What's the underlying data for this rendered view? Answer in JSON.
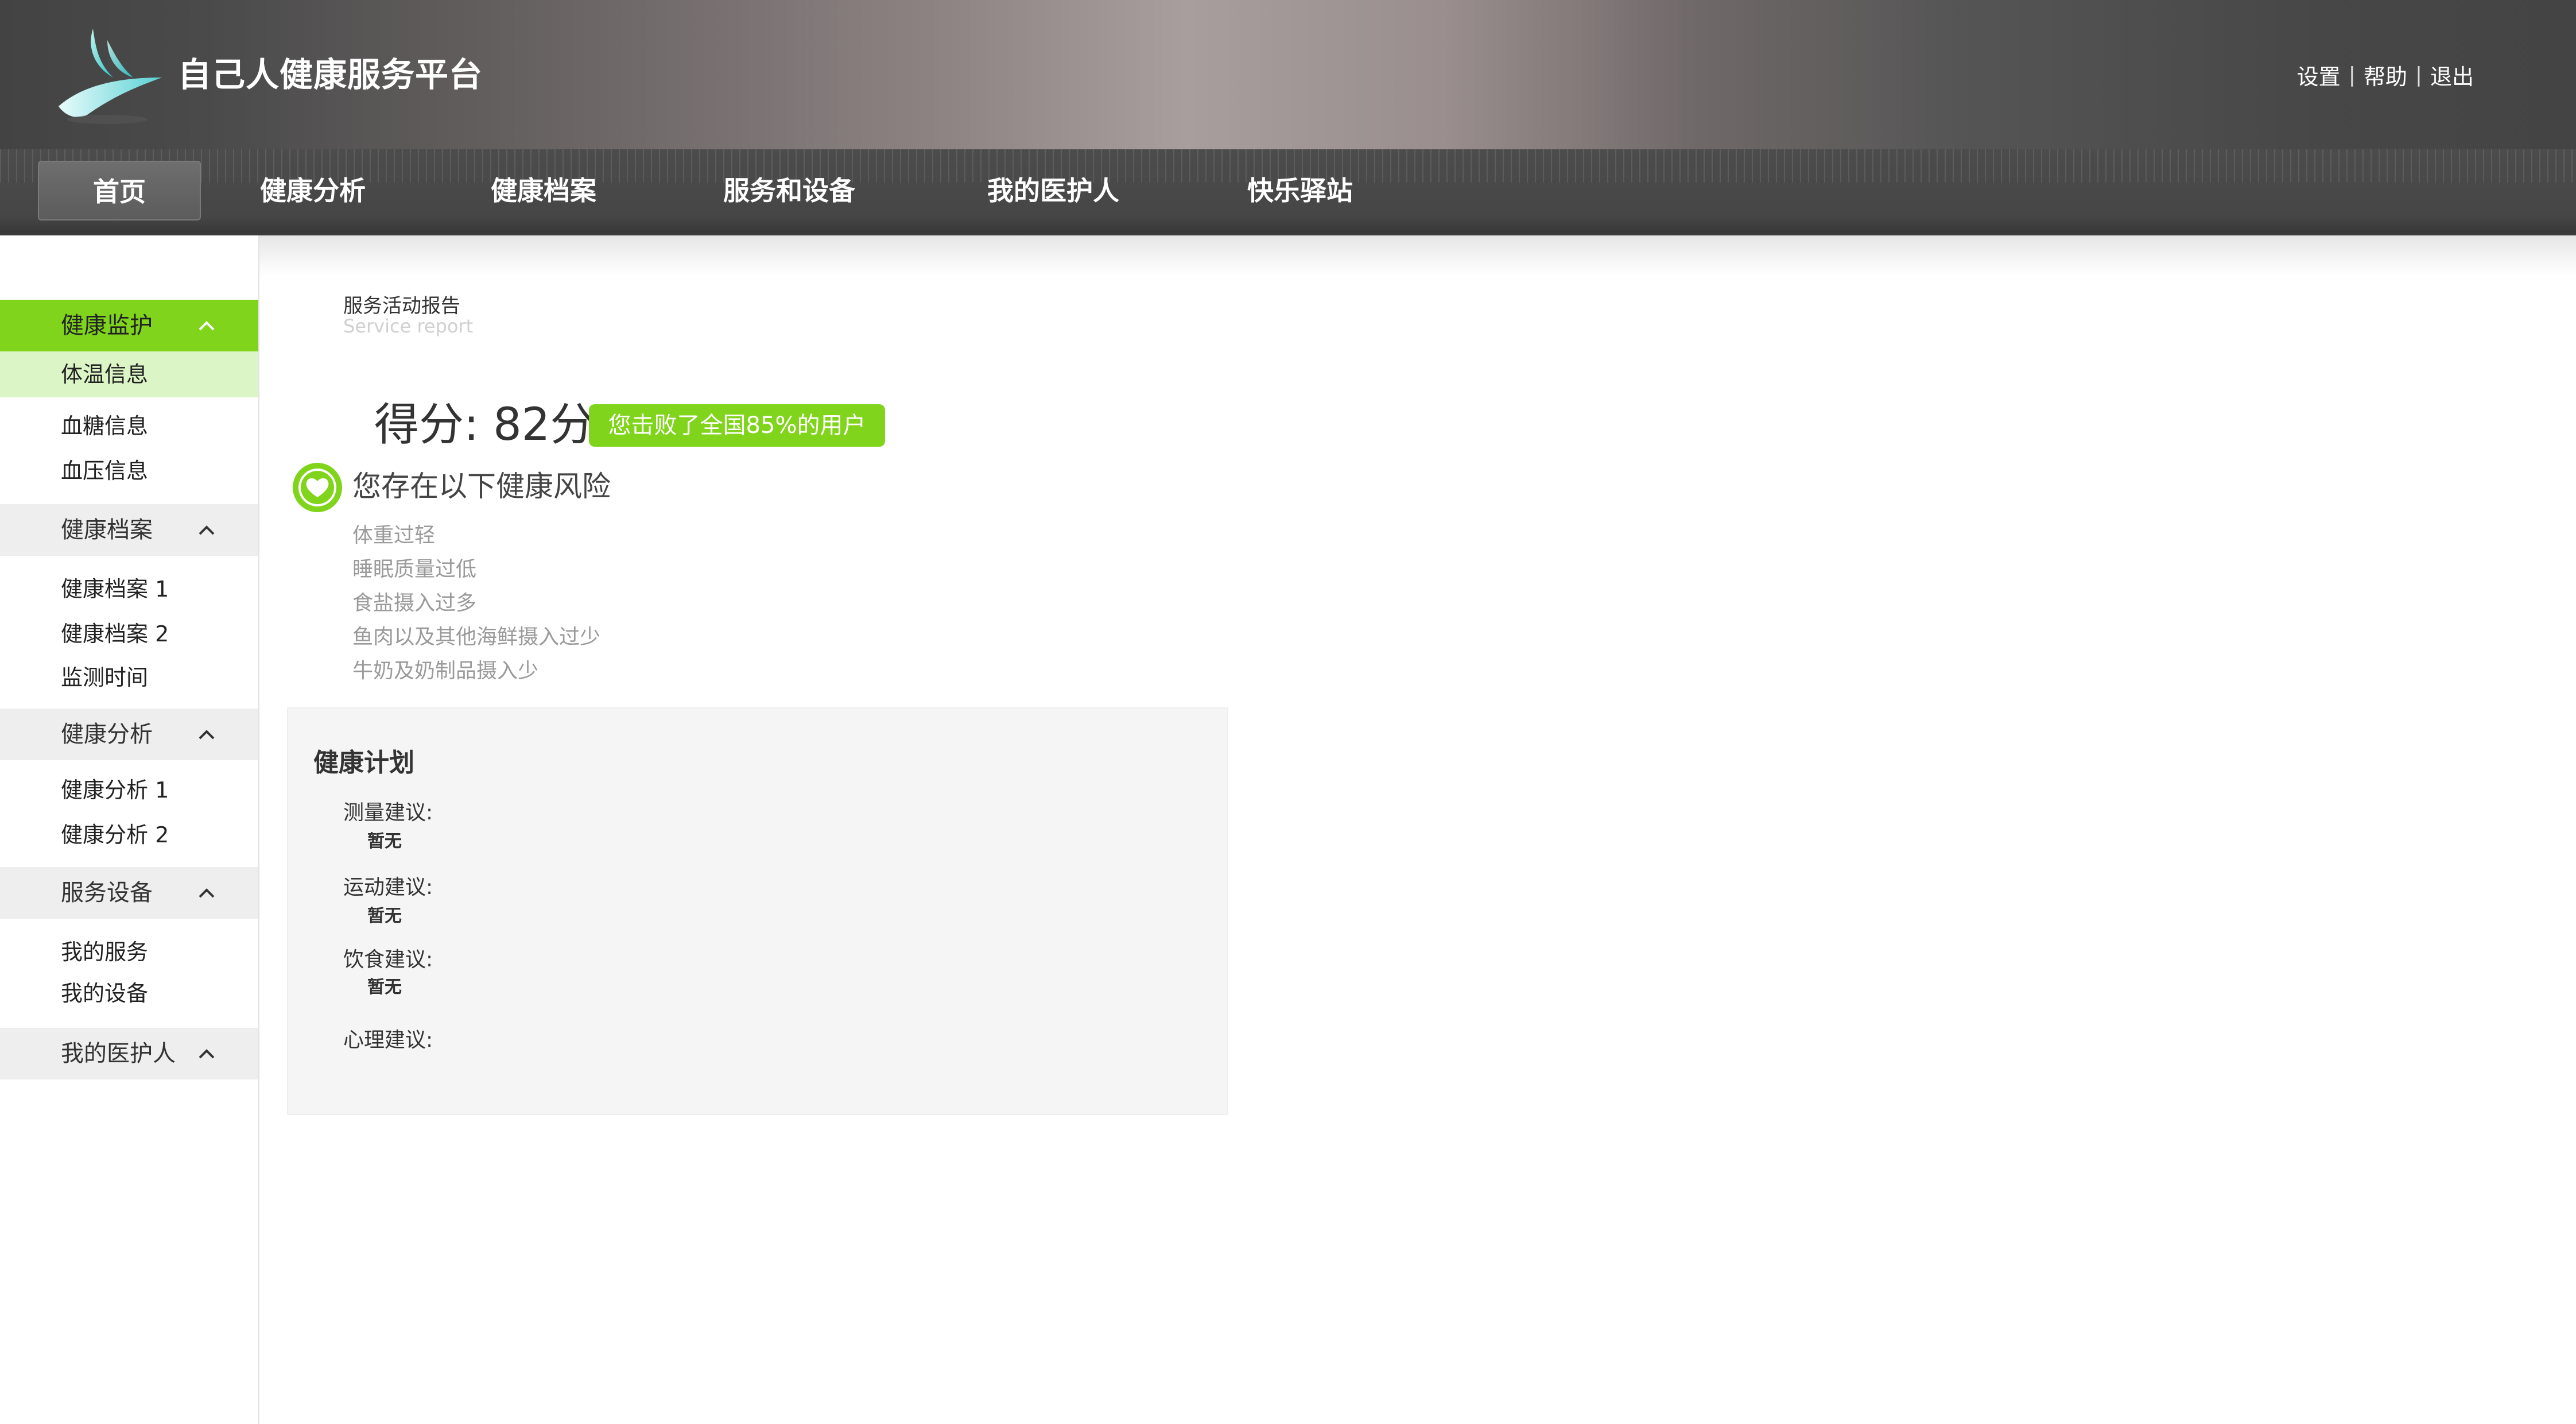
{
  "app": {
    "title": "自己人健康服务平台"
  },
  "top_links": [
    "设置",
    "帮助",
    "退出"
  ],
  "nav": {
    "items": [
      "首页",
      "健康分析",
      "健康档案",
      "服务和设备",
      "我的医护人",
      "快乐驿站"
    ],
    "active": "首页"
  },
  "sidebar": {
    "groups": [
      {
        "label": "健康监护",
        "expanded": true,
        "active": true,
        "items": [
          "体温信息",
          "血糖信息",
          "血压信息"
        ],
        "active_item": "体温信息"
      },
      {
        "label": "健康档案",
        "expanded": true,
        "items": [
          "健康档案 1",
          "健康档案 2",
          "监测时间"
        ]
      },
      {
        "label": "健康分析",
        "expanded": true,
        "items": [
          "健康分析 1",
          "健康分析 2"
        ]
      },
      {
        "label": "服务设备",
        "expanded": true,
        "items": [
          "我的服务",
          "我的设备"
        ]
      },
      {
        "label": "我的医护人",
        "expanded": true,
        "items": []
      }
    ]
  },
  "report": {
    "title_cn": "服务活动报告",
    "title_en": "Service report",
    "score_text": "得分: 82分",
    "badge": "您击败了全国85%的用户",
    "risk_title": "您存在以下健康风险",
    "risks": [
      "体重过轻",
      "睡眠质量过低",
      "食盐摄入过多",
      "鱼肉以及其他海鲜摄入过少",
      "牛奶及奶制品摄入少"
    ]
  },
  "plan": {
    "title": "健康计划",
    "items": [
      {
        "label": "测量建议:",
        "value": "暂无"
      },
      {
        "label": "运动建议:",
        "value": "暂无"
      },
      {
        "label": "饮食建议:",
        "value": "暂无"
      },
      {
        "label": "心理建议:",
        "value": ""
      }
    ]
  },
  "colors": {
    "accent_green": "#80d41c",
    "active_item_bg": "#dcf5c6",
    "header_dark": "#444444",
    "nav_bg": "#4c4c4c"
  },
  "icons": {
    "logo": "bird-logo-icon",
    "chevron": "chevron-up-icon",
    "heart": "heart-icon"
  }
}
